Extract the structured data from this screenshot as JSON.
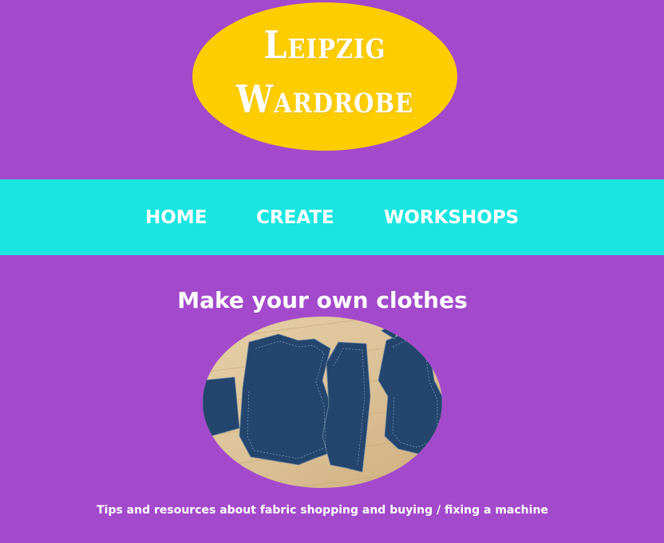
{
  "logo": {
    "line1": "Leipzig",
    "line2": "Wardrobe",
    "background_color": "#fdcd00",
    "text_color": "#ffffff"
  },
  "nav": {
    "items": [
      {
        "label": "HOME"
      },
      {
        "label": "CREATE"
      },
      {
        "label": "WORKSHOPS"
      }
    ],
    "background_color": "#19e6e0"
  },
  "main": {
    "heading": "Make your own clothes",
    "caption": "Tips and resources about fabric shopping and buying / fixing a machine"
  },
  "colors": {
    "page_background": "#a24acb",
    "fabric": "#23456e",
    "floor": "#dcc298"
  }
}
